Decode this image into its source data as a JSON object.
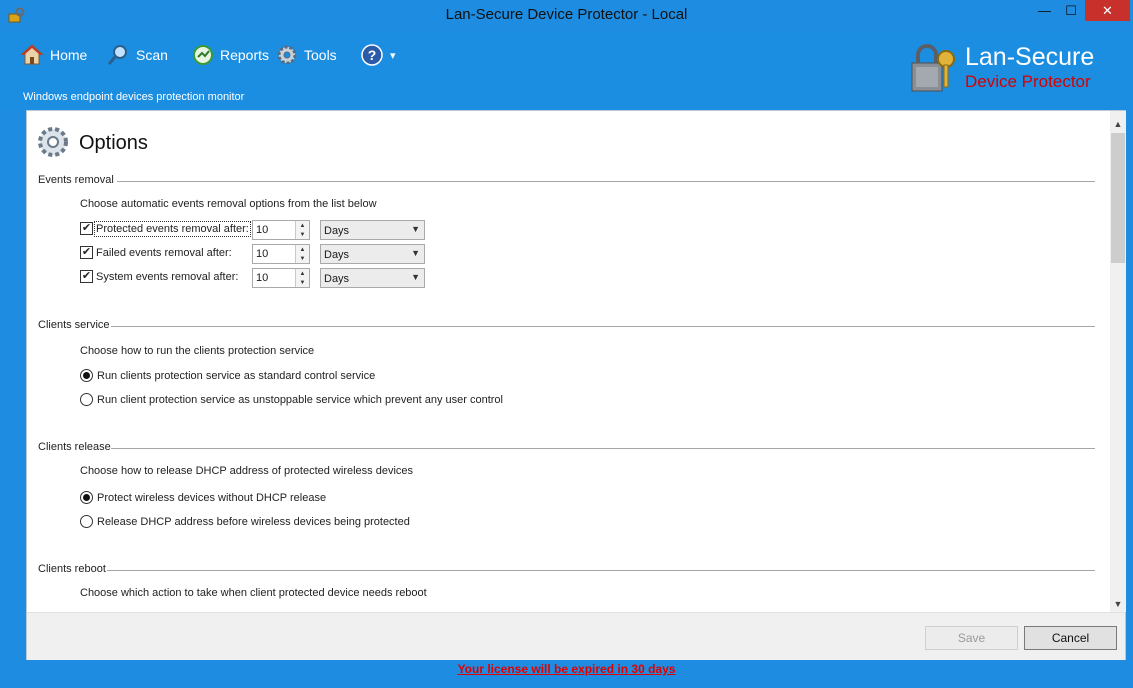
{
  "window": {
    "title": "Lan-Secure Device Protector - Local",
    "minimize": "—",
    "maximize": "☐",
    "close": "✕"
  },
  "toolbar": {
    "home": "Home",
    "scan": "Scan",
    "reports": "Reports",
    "tools": "Tools",
    "help_caret": "▾",
    "subtitle": "Windows endpoint devices protection monitor"
  },
  "brand": {
    "title": "Lan-Secure",
    "subtitle": "Device Protector"
  },
  "page": {
    "title": "Options"
  },
  "sections": {
    "events_removal": {
      "label": "Events removal",
      "description": "Choose automatic events removal options from the list below",
      "rows": [
        {
          "label": "Protected events removal after:",
          "checked": true,
          "value": "10",
          "unit": "Days"
        },
        {
          "label": "Failed events removal after:",
          "checked": true,
          "value": "10",
          "unit": "Days"
        },
        {
          "label": "System events removal after:",
          "checked": true,
          "value": "10",
          "unit": "Days"
        }
      ]
    },
    "clients_service": {
      "label": "Clients service",
      "description": "Choose how to run the clients protection service",
      "options": [
        {
          "label": "Run clients protection service as standard control service",
          "selected": true
        },
        {
          "label": "Run client protection service as unstoppable service which prevent any user control",
          "selected": false
        }
      ]
    },
    "clients_release": {
      "label": "Clients release",
      "description": "Choose how to release DHCP address of protected wireless devices",
      "options": [
        {
          "label": "Protect wireless devices without DHCP release",
          "selected": true
        },
        {
          "label": "Release DHCP address before wireless devices being protected",
          "selected": false
        }
      ]
    },
    "clients_reboot": {
      "label": "Clients reboot",
      "description": "Choose which action to take when client protected device needs reboot"
    }
  },
  "buttons": {
    "save": "Save",
    "cancel": "Cancel"
  },
  "scrollbar": {
    "up": "▲",
    "down": "▼"
  },
  "status": {
    "license": "Your license will be expired in 30 days"
  },
  "colors": {
    "accent": "#1e8ce0",
    "brand_red": "#d40000",
    "license_red": "#e00000"
  },
  "icons": {
    "app": "key-lock-icon",
    "home": "house-icon",
    "scan": "magnifier-icon",
    "reports": "refresh-chart-icon",
    "tools": "gear-icon",
    "help": "question-icon",
    "options": "gear-icon"
  }
}
